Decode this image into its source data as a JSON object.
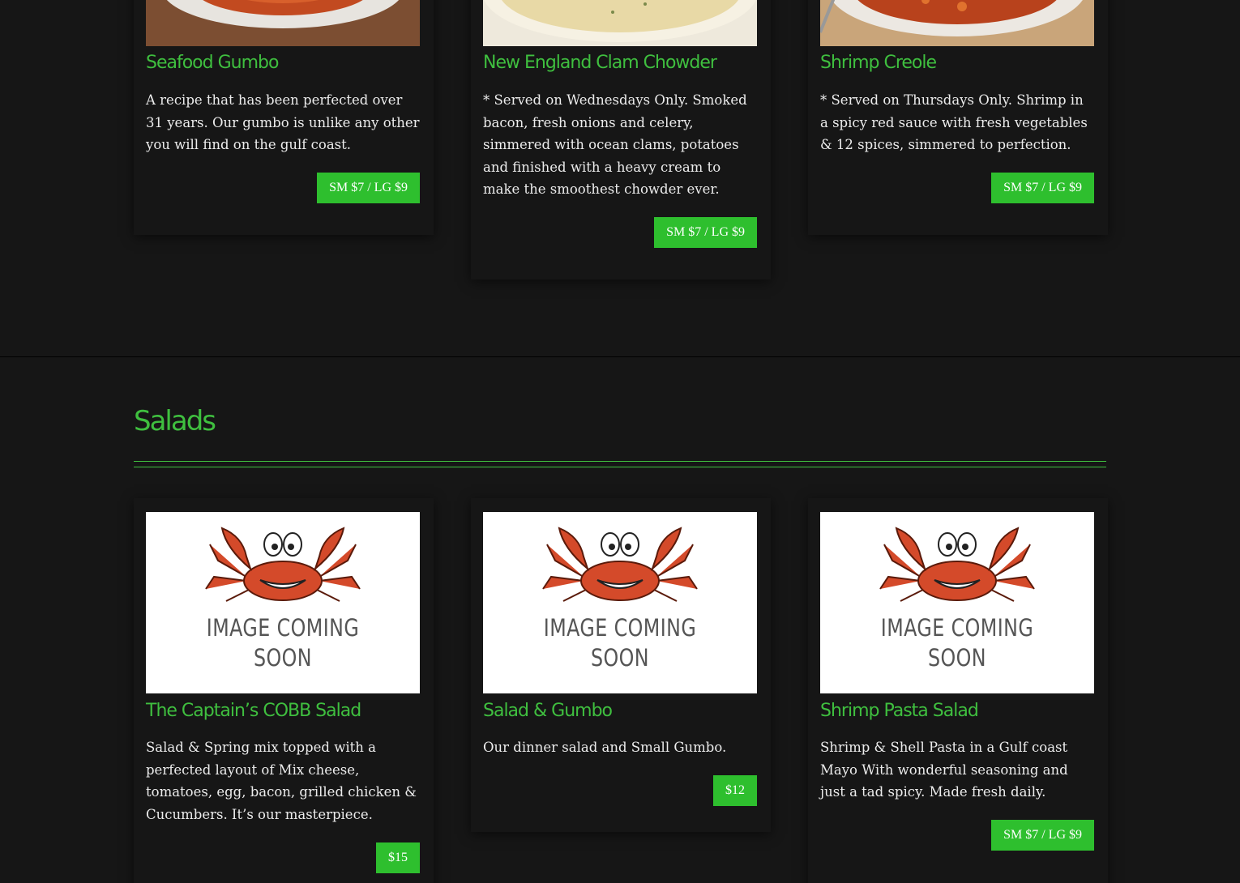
{
  "soups": [
    {
      "title": "Seafood Gumbo",
      "description": "A recipe that has been perfected over 31 years. Our gumbo is unlike any other you will find on the gulf coast.",
      "price": "SM $7 / LG $9"
    },
    {
      "title": "New England Clam Chowder",
      "description": "* Served on Wednesdays Only. Smoked bacon, fresh onions and celery, simmered with ocean clams, potatoes and finished with a heavy cream to make the smoothest chowder ever.",
      "price": "SM $7 / LG $9"
    },
    {
      "title": "Shrimp Creole",
      "description": "* Served on Thursdays Only. Shrimp in a spicy red sauce with fresh vegetables & 12 spices, simmered to perfection.",
      "price": "SM $7 / LG $9"
    }
  ],
  "salads_section": {
    "title": "Salads"
  },
  "placeholder": {
    "line1": "IMAGE COMING",
    "line2": "SOON"
  },
  "salads": [
    {
      "title": "The Captain’s COBB Salad",
      "description": "Salad & Spring mix topped with a perfected layout of Mix cheese, tomatoes, egg, bacon, grilled chicken & Cucumbers. It’s our masterpiece.",
      "price": "$15"
    },
    {
      "title": "Salad & Gumbo",
      "description": "Our dinner salad and Small Gumbo.",
      "price": "$12"
    },
    {
      "title": "Shrimp Pasta Salad",
      "description": "Shrimp & Shell Pasta in a Gulf coast Mayo With wonderful seasoning and just a tad spicy. Made fresh daily.",
      "price": "SM $7 / LG $9"
    }
  ],
  "colors": {
    "accent": "#3fbf3f",
    "button": "#2ebf2e",
    "background": "#161616"
  }
}
